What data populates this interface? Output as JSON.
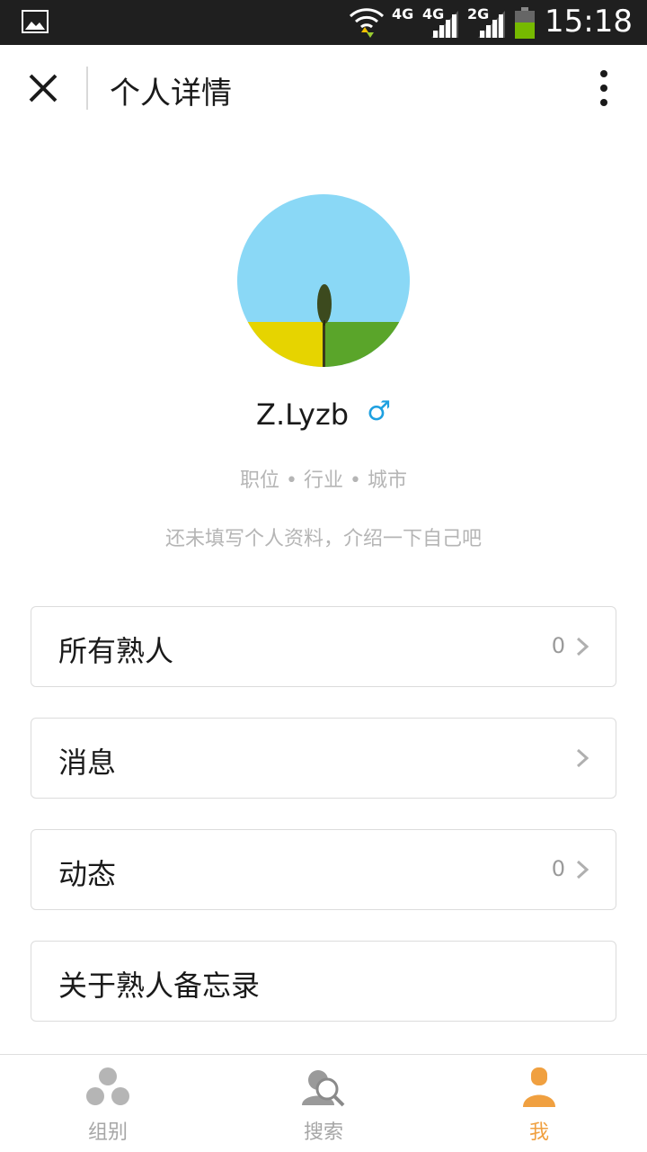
{
  "status_bar": {
    "network_1": "4G",
    "network_2": "4G",
    "network_3": "2G",
    "time": "15:18",
    "icons": [
      "gallery-icon",
      "wifi-icon",
      "signal-icon",
      "battery-icon"
    ]
  },
  "header": {
    "title": "个人详情",
    "close_icon": "close-icon",
    "more_icon": "more-vertical-icon"
  },
  "profile": {
    "username": "Z.Lyzb",
    "gender_symbol": "♂",
    "meta": "职位 • 行业 • 城市",
    "bio_placeholder": "还未填写个人资料，介绍一下自己吧"
  },
  "menu": [
    {
      "label": "所有熟人",
      "count": "0"
    },
    {
      "label": "消息",
      "count": ""
    },
    {
      "label": "动态",
      "count": "0"
    },
    {
      "label": "关于熟人备忘录",
      "count": ""
    }
  ],
  "bottom_nav": {
    "items": [
      {
        "label": "组别",
        "icon": "groups-icon"
      },
      {
        "label": "搜索",
        "icon": "search-person-icon"
      },
      {
        "label": "我",
        "icon": "me-icon"
      }
    ],
    "active_index": 2
  },
  "colors": {
    "accent": "#f0a040",
    "gender": "#1ea0e0",
    "status_bar_bg": "#1f1f1f"
  }
}
